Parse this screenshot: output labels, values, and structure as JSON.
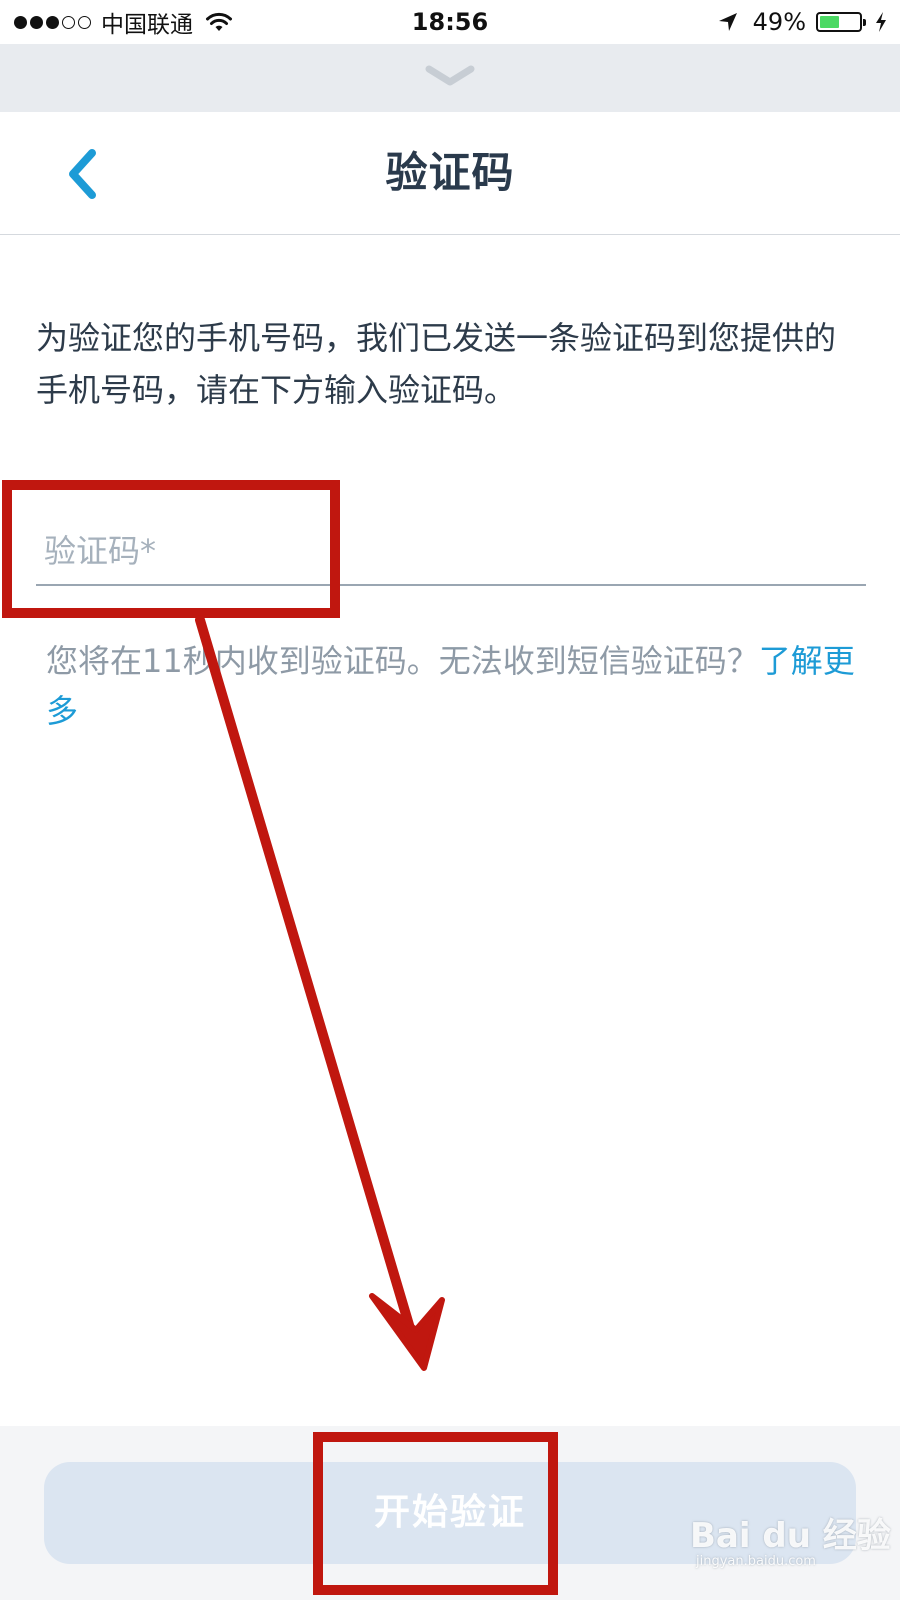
{
  "status_bar": {
    "carrier": "中国联通",
    "time": "18:56",
    "battery_percent": "49%",
    "battery_level": 0.49,
    "signal_bars_filled": 3,
    "signal_bars_total": 5,
    "icons": [
      "wifi-icon",
      "location-arrow-icon",
      "battery-icon",
      "charging-icon"
    ]
  },
  "sheet": {
    "handle_icon": "chevron-down-icon"
  },
  "header": {
    "back_icon": "chevron-left-icon",
    "title": "验证码"
  },
  "main": {
    "instructions": "为验证您的手机号码，我们已发送一条验证码到您提供的手机号码，请在下方输入验证码。",
    "code_input": {
      "value": "",
      "placeholder": "验证码*"
    },
    "resend_note": "您将在11秒内收到验证码。无法收到短信验证码？",
    "learn_more_link": "了解更多"
  },
  "footer": {
    "start_button_label": "开始验证"
  },
  "watermark": {
    "main": "Bai du 经验",
    "sub": "jingyan.baidu.com"
  },
  "colors": {
    "accent": "#1d9bd6",
    "title": "#2a3a4c",
    "muted_text": "#8e9aa6",
    "button_disabled_bg": "#dbe5f1",
    "annotation_red": "#c0170f",
    "battery_green": "#4cd964"
  }
}
